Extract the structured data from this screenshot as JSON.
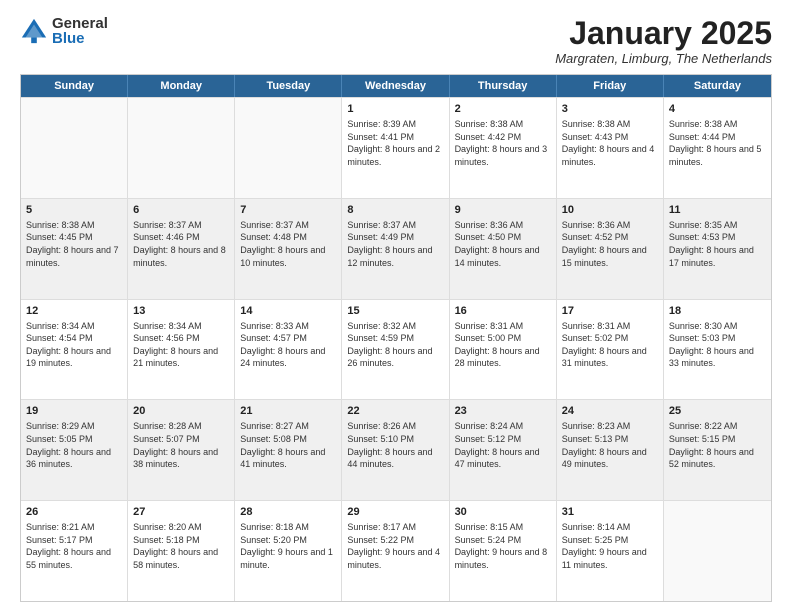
{
  "logo": {
    "general": "General",
    "blue": "Blue"
  },
  "title": "January 2025",
  "location": "Margraten, Limburg, The Netherlands",
  "days": [
    "Sunday",
    "Monday",
    "Tuesday",
    "Wednesday",
    "Thursday",
    "Friday",
    "Saturday"
  ],
  "weeks": [
    [
      {
        "day": "",
        "content": "",
        "empty": true
      },
      {
        "day": "",
        "content": "",
        "empty": true
      },
      {
        "day": "",
        "content": "",
        "empty": true
      },
      {
        "day": "1",
        "content": "Sunrise: 8:39 AM\nSunset: 4:41 PM\nDaylight: 8 hours and 2 minutes."
      },
      {
        "day": "2",
        "content": "Sunrise: 8:38 AM\nSunset: 4:42 PM\nDaylight: 8 hours and 3 minutes."
      },
      {
        "day": "3",
        "content": "Sunrise: 8:38 AM\nSunset: 4:43 PM\nDaylight: 8 hours and 4 minutes."
      },
      {
        "day": "4",
        "content": "Sunrise: 8:38 AM\nSunset: 4:44 PM\nDaylight: 8 hours and 5 minutes."
      }
    ],
    [
      {
        "day": "5",
        "content": "Sunrise: 8:38 AM\nSunset: 4:45 PM\nDaylight: 8 hours and 7 minutes.",
        "shaded": true
      },
      {
        "day": "6",
        "content": "Sunrise: 8:37 AM\nSunset: 4:46 PM\nDaylight: 8 hours and 8 minutes.",
        "shaded": true
      },
      {
        "day": "7",
        "content": "Sunrise: 8:37 AM\nSunset: 4:48 PM\nDaylight: 8 hours and 10 minutes.",
        "shaded": true
      },
      {
        "day": "8",
        "content": "Sunrise: 8:37 AM\nSunset: 4:49 PM\nDaylight: 8 hours and 12 minutes.",
        "shaded": true
      },
      {
        "day": "9",
        "content": "Sunrise: 8:36 AM\nSunset: 4:50 PM\nDaylight: 8 hours and 14 minutes.",
        "shaded": true
      },
      {
        "day": "10",
        "content": "Sunrise: 8:36 AM\nSunset: 4:52 PM\nDaylight: 8 hours and 15 minutes.",
        "shaded": true
      },
      {
        "day": "11",
        "content": "Sunrise: 8:35 AM\nSunset: 4:53 PM\nDaylight: 8 hours and 17 minutes.",
        "shaded": true
      }
    ],
    [
      {
        "day": "12",
        "content": "Sunrise: 8:34 AM\nSunset: 4:54 PM\nDaylight: 8 hours and 19 minutes."
      },
      {
        "day": "13",
        "content": "Sunrise: 8:34 AM\nSunset: 4:56 PM\nDaylight: 8 hours and 21 minutes."
      },
      {
        "day": "14",
        "content": "Sunrise: 8:33 AM\nSunset: 4:57 PM\nDaylight: 8 hours and 24 minutes."
      },
      {
        "day": "15",
        "content": "Sunrise: 8:32 AM\nSunset: 4:59 PM\nDaylight: 8 hours and 26 minutes."
      },
      {
        "day": "16",
        "content": "Sunrise: 8:31 AM\nSunset: 5:00 PM\nDaylight: 8 hours and 28 minutes."
      },
      {
        "day": "17",
        "content": "Sunrise: 8:31 AM\nSunset: 5:02 PM\nDaylight: 8 hours and 31 minutes."
      },
      {
        "day": "18",
        "content": "Sunrise: 8:30 AM\nSunset: 5:03 PM\nDaylight: 8 hours and 33 minutes."
      }
    ],
    [
      {
        "day": "19",
        "content": "Sunrise: 8:29 AM\nSunset: 5:05 PM\nDaylight: 8 hours and 36 minutes.",
        "shaded": true
      },
      {
        "day": "20",
        "content": "Sunrise: 8:28 AM\nSunset: 5:07 PM\nDaylight: 8 hours and 38 minutes.",
        "shaded": true
      },
      {
        "day": "21",
        "content": "Sunrise: 8:27 AM\nSunset: 5:08 PM\nDaylight: 8 hours and 41 minutes.",
        "shaded": true
      },
      {
        "day": "22",
        "content": "Sunrise: 8:26 AM\nSunset: 5:10 PM\nDaylight: 8 hours and 44 minutes.",
        "shaded": true
      },
      {
        "day": "23",
        "content": "Sunrise: 8:24 AM\nSunset: 5:12 PM\nDaylight: 8 hours and 47 minutes.",
        "shaded": true
      },
      {
        "day": "24",
        "content": "Sunrise: 8:23 AM\nSunset: 5:13 PM\nDaylight: 8 hours and 49 minutes.",
        "shaded": true
      },
      {
        "day": "25",
        "content": "Sunrise: 8:22 AM\nSunset: 5:15 PM\nDaylight: 8 hours and 52 minutes.",
        "shaded": true
      }
    ],
    [
      {
        "day": "26",
        "content": "Sunrise: 8:21 AM\nSunset: 5:17 PM\nDaylight: 8 hours and 55 minutes."
      },
      {
        "day": "27",
        "content": "Sunrise: 8:20 AM\nSunset: 5:18 PM\nDaylight: 8 hours and 58 minutes."
      },
      {
        "day": "28",
        "content": "Sunrise: 8:18 AM\nSunset: 5:20 PM\nDaylight: 9 hours and 1 minute."
      },
      {
        "day": "29",
        "content": "Sunrise: 8:17 AM\nSunset: 5:22 PM\nDaylight: 9 hours and 4 minutes."
      },
      {
        "day": "30",
        "content": "Sunrise: 8:15 AM\nSunset: 5:24 PM\nDaylight: 9 hours and 8 minutes."
      },
      {
        "day": "31",
        "content": "Sunrise: 8:14 AM\nSunset: 5:25 PM\nDaylight: 9 hours and 11 minutes."
      },
      {
        "day": "",
        "content": "",
        "empty": true
      }
    ]
  ]
}
